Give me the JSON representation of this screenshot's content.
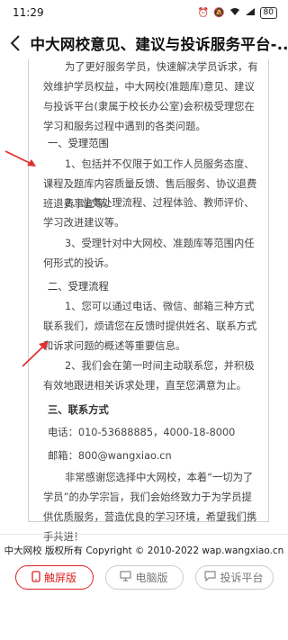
{
  "status_bar": {
    "time": "11:29",
    "battery": "80"
  },
  "header": {
    "title": "中大网校意见、建议与投诉服务平台-..."
  },
  "content": {
    "intro": "为了更好服务学员，快速解决学员诉求，有效维护学员权益，中大网校(准题库)意见、建议与投诉平台(隶属于校长办公室)会积极受理您在学习和服务过程中遇到的各类问题。",
    "section1_heading": "一、受理范围",
    "s1_item1": "1、包括并不仅限于如工作人员服务态度、课程及题库内容质量反馈、售后服务、协议退费班退费事宜等。",
    "s1_item2": "2、业务处理流程、过程体验、教师评价、学习改进建议等。",
    "s1_item3": "3、受理针对中大网校、准题库等范围内任何形式的投诉。",
    "section2_heading": "二、受理流程",
    "s2_item1": "1、您可以通过电话、微信、邮箱三种方式联系我们，烦请您在反馈时提供姓名、联系方式和诉求问题的概述等重要信息。",
    "s2_item2": "2、我们会在第一时间主动联系您，并积极有效地跟进相关诉求处理，直至您满意为止。",
    "section3_heading": "三、联系方式",
    "phone": "电话：010-53688885，4000-18-8000",
    "email": "邮箱：800@wangxiao.cn",
    "closing": "非常感谢您选择中大网校，本着“一切为了学员”的办学宗旨，我们会始终致力于为学员提供优质服务，营造优良的学习环境，希望我们携手共进！"
  },
  "footer": {
    "copyright": "中大网校 版权所有 Copyright © 2010-2022 wap.wangxiao.cn",
    "buttons": {
      "touch": "触屏版",
      "pc": "电脑版",
      "complaint": "投诉平台"
    }
  },
  "colors": {
    "accent": "#dd2222",
    "arrow": "#e03030"
  }
}
